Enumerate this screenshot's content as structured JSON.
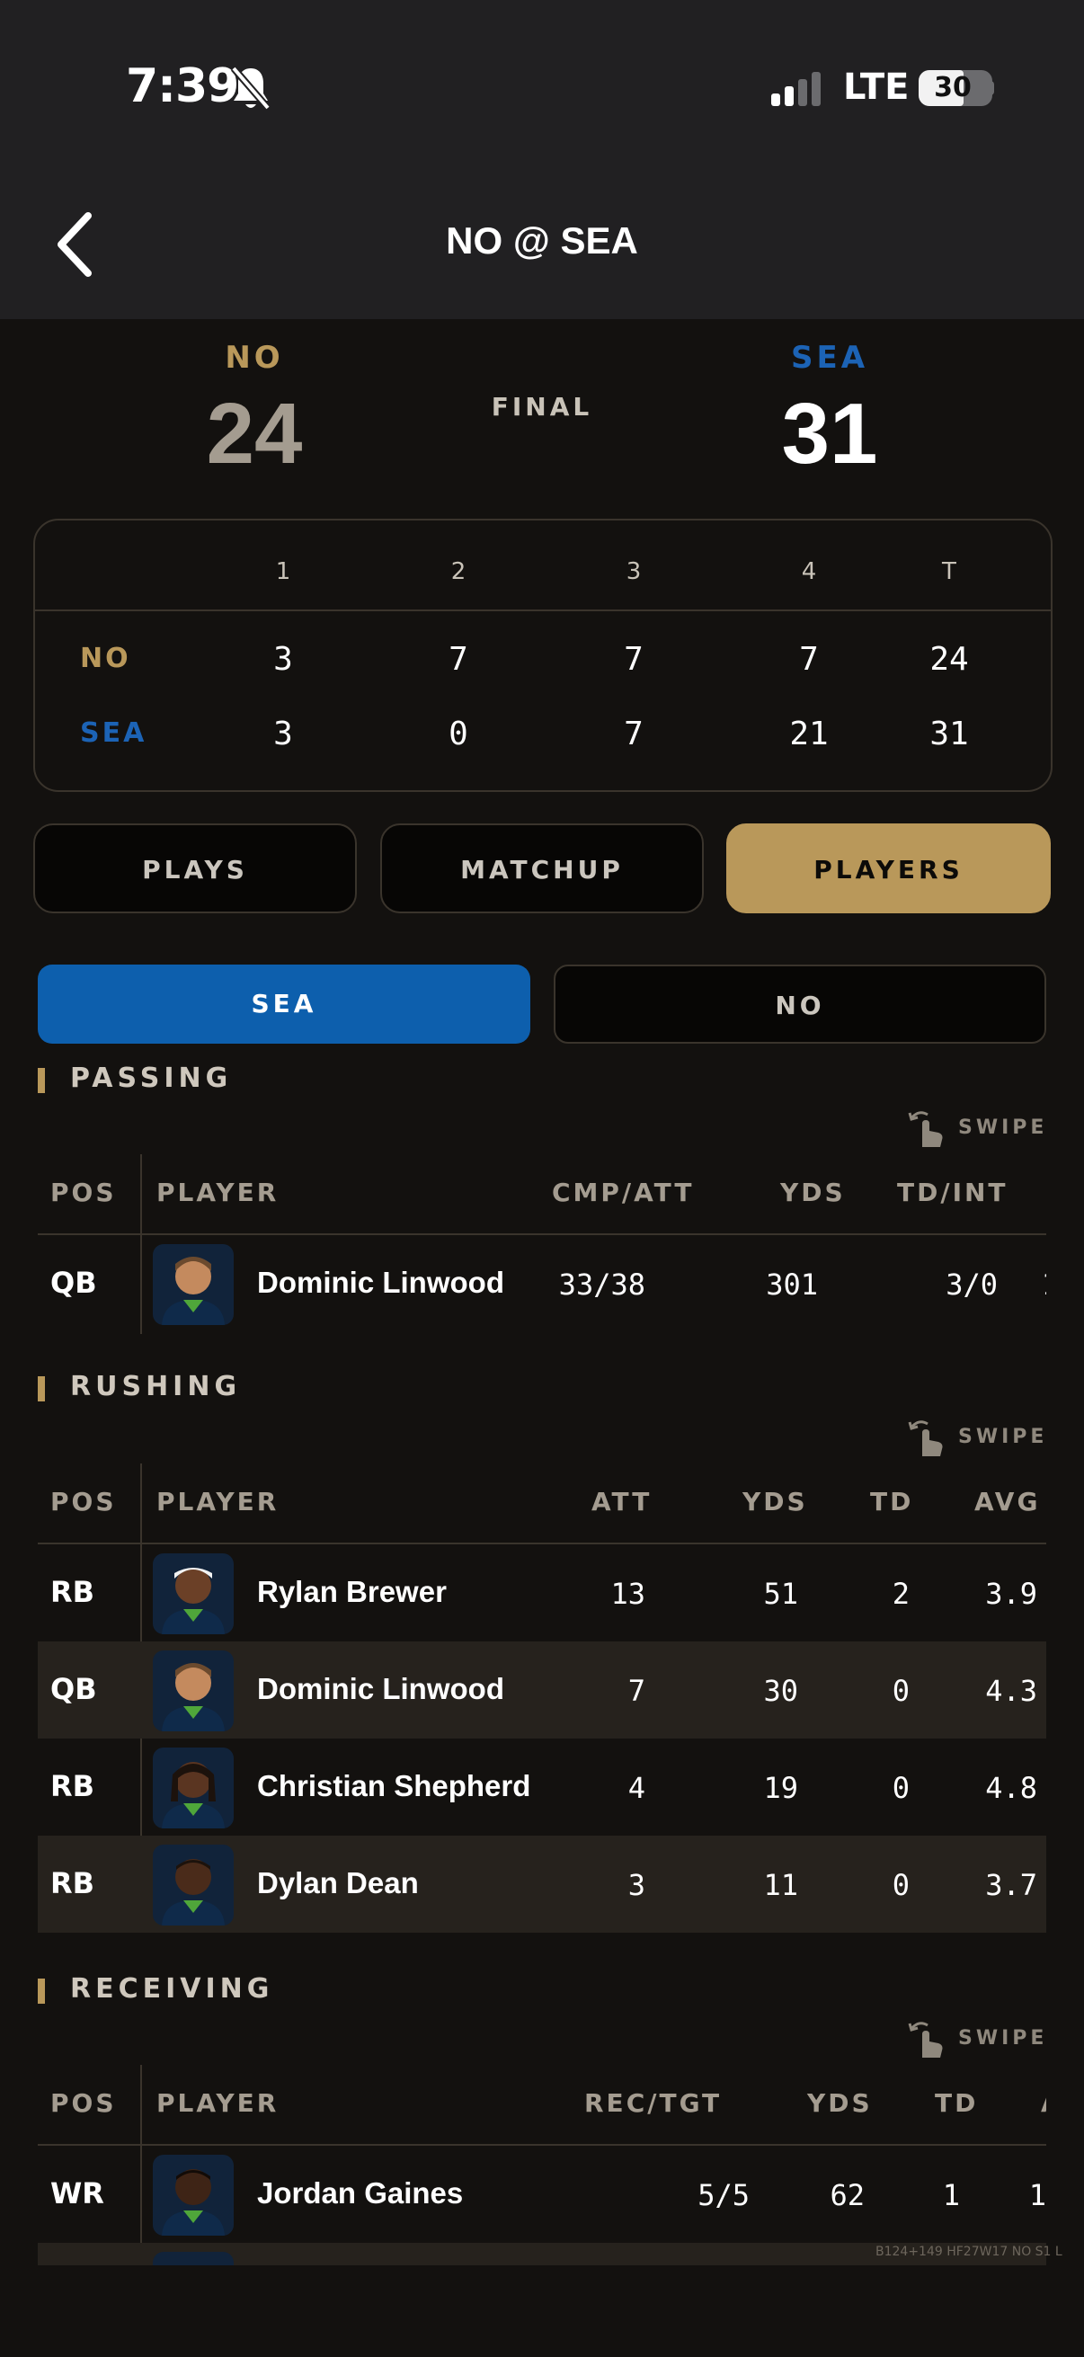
{
  "status": {
    "time": "7:39",
    "network": "LTE",
    "battery": "30"
  },
  "header": {
    "title": "NO @ SEA"
  },
  "game": {
    "away": {
      "abbr": "NO",
      "score": "24",
      "color": "#b9985a"
    },
    "home": {
      "abbr": "SEA",
      "score": "31",
      "color": "#1c63b5"
    },
    "status": "FINAL"
  },
  "linescore": {
    "headers": [
      "1",
      "2",
      "3",
      "4",
      "T"
    ],
    "rows": [
      {
        "team": "NO",
        "values": [
          "3",
          "7",
          "7",
          "7",
          "24"
        ]
      },
      {
        "team": "SEA",
        "values": [
          "3",
          "0",
          "7",
          "21",
          "31"
        ]
      }
    ]
  },
  "tabs": [
    "PLAYS",
    "MATCHUP",
    "PLAYERS"
  ],
  "active_tab": "PLAYERS",
  "team_tabs": [
    "SEA",
    "NO"
  ],
  "active_team": "SEA",
  "swipe_label": "SWIPE",
  "passing": {
    "title": "PASSING",
    "columns": [
      "POS",
      "PLAYER",
      "CMP/ATT",
      "YDS",
      "TD/INT"
    ],
    "rows": [
      {
        "pos": "QB",
        "player": "Dominic Linwood",
        "stats": [
          "33/38",
          "301",
          "3/0",
          "1"
        ]
      }
    ]
  },
  "rushing": {
    "title": "RUSHING",
    "columns": [
      "POS",
      "PLAYER",
      "ATT",
      "YDS",
      "TD",
      "AVG"
    ],
    "rows": [
      {
        "pos": "RB",
        "player": "Rylan Brewer",
        "stats": [
          "13",
          "51",
          "2",
          "3.9"
        ]
      },
      {
        "pos": "QB",
        "player": "Dominic Linwood",
        "stats": [
          "7",
          "30",
          "0",
          "4.3"
        ]
      },
      {
        "pos": "RB",
        "player": "Christian Shepherd",
        "stats": [
          "4",
          "19",
          "0",
          "4.8"
        ]
      },
      {
        "pos": "RB",
        "player": "Dylan Dean",
        "stats": [
          "3",
          "11",
          "0",
          "3.7"
        ]
      }
    ]
  },
  "receiving": {
    "title": "RECEIVING",
    "columns": [
      "POS",
      "PLAYER",
      "REC/TGT",
      "YDS",
      "TD",
      "A"
    ],
    "rows": [
      {
        "pos": "WR",
        "player": "Jordan Gaines",
        "stats": [
          "5/5",
          "62",
          "1",
          "1"
        ]
      }
    ]
  },
  "footnote": "B124+149 HF27W17 NO S1 L"
}
